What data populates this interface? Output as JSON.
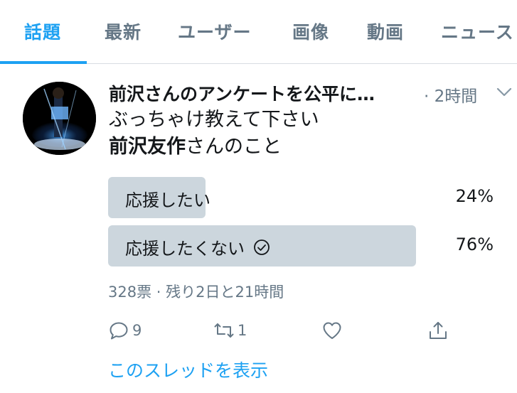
{
  "tabs": [
    {
      "label": "話題",
      "active": true
    },
    {
      "label": "最新",
      "active": false
    },
    {
      "label": "ユーザー",
      "active": false
    },
    {
      "label": "画像",
      "active": false
    },
    {
      "label": "動画",
      "active": false
    },
    {
      "label": "ニュース",
      "active": false
    }
  ],
  "tweet": {
    "author": "前沢さんのアンケートを公平に…",
    "time": "· 2時間",
    "text_line1": "ぶっちゃけ教えて下さい",
    "text_bold": "前沢友作",
    "text_rest": "さんのこと"
  },
  "poll": {
    "options": [
      {
        "label": "応援したい",
        "percent_text": "24%",
        "percent": 24,
        "selected": false
      },
      {
        "label": "応援したくない",
        "percent_text": "76%",
        "percent": 76,
        "selected": true
      }
    ],
    "meta": "328票 · 残り2日と21時間"
  },
  "actions": {
    "reply_count": "9",
    "retweet_count": "1",
    "like_count": "",
    "share_count": ""
  },
  "thread_link": "このスレッドを表示",
  "colors": {
    "accent": "#1da1f2",
    "muted": "#657786",
    "poll_bar": "#ccd6dd",
    "text": "#14171a"
  },
  "icons": [
    "reply-icon",
    "retweet-icon",
    "like-icon",
    "share-icon",
    "chevron-down-icon",
    "check-circle-icon"
  ]
}
